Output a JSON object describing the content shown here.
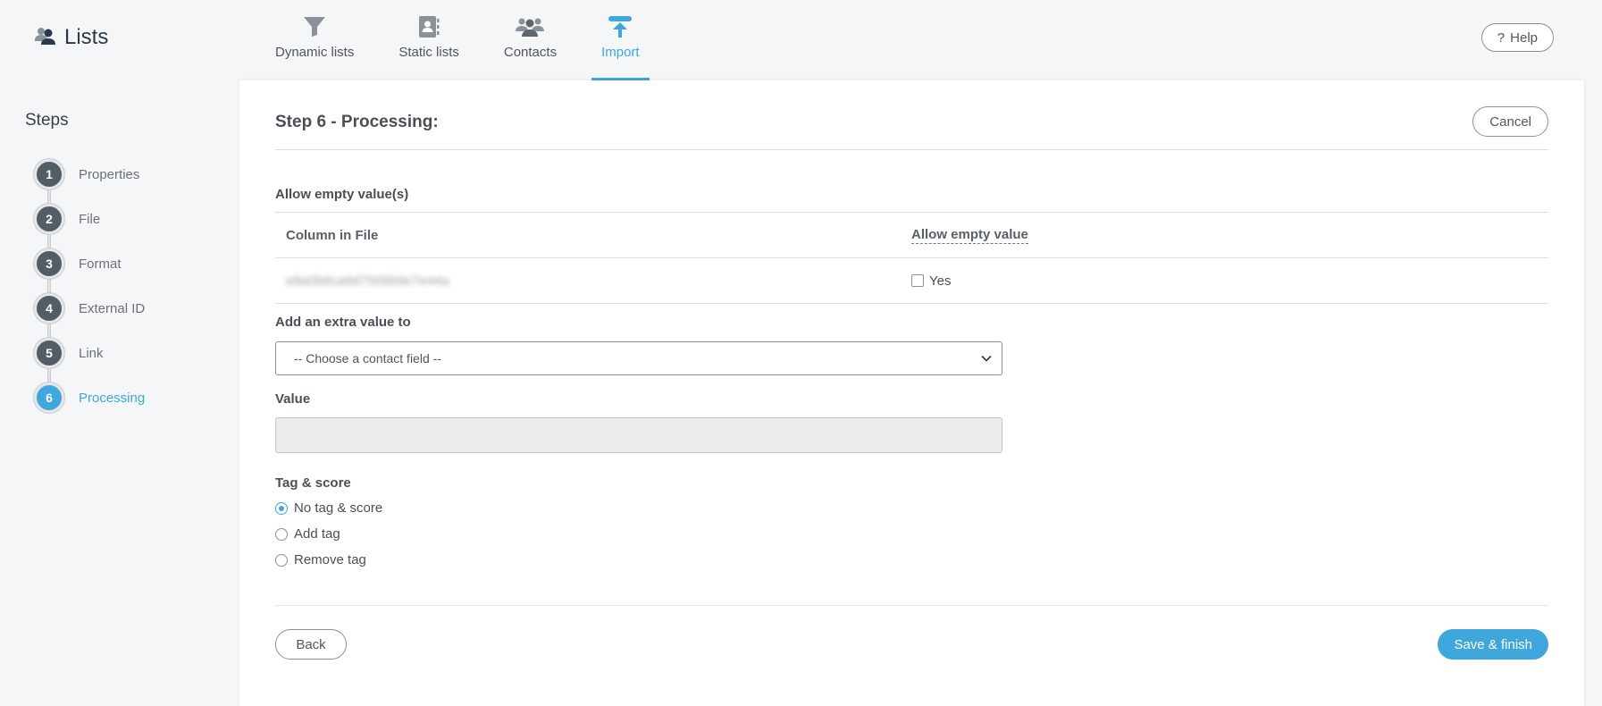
{
  "app": {
    "title": "Lists"
  },
  "nav": {
    "items": [
      {
        "label": "Dynamic lists",
        "icon": "filter-icon"
      },
      {
        "label": "Static lists",
        "icon": "address-book-icon"
      },
      {
        "label": "Contacts",
        "icon": "users-icon"
      },
      {
        "label": "Import",
        "icon": "import-icon",
        "active": true
      }
    ]
  },
  "header": {
    "help_label": "Help"
  },
  "sidebar": {
    "title": "Steps",
    "steps": [
      {
        "number": "1",
        "label": "Properties"
      },
      {
        "number": "2",
        "label": "File"
      },
      {
        "number": "3",
        "label": "Format"
      },
      {
        "number": "4",
        "label": "External ID"
      },
      {
        "number": "5",
        "label": "Link"
      },
      {
        "number": "6",
        "label": "Processing",
        "active": true
      }
    ]
  },
  "main": {
    "title": "Step 6 - Processing:",
    "cancel_label": "Cancel",
    "empty_values": {
      "section_label": "Allow empty value(s)",
      "col_file": "Column in File",
      "col_allow": "Allow empty value",
      "rows": [
        {
          "column": "e8a0b6ca9d7509b9e7e44a",
          "allow_label": "Yes"
        }
      ]
    },
    "extra_value": {
      "label": "Add an extra value to",
      "select_value": "-- Choose a contact field --"
    },
    "value": {
      "label": "Value",
      "current": ""
    },
    "tag_score": {
      "label": "Tag & score",
      "options": [
        {
          "label": "No tag & score",
          "checked": true
        },
        {
          "label": "Add tag"
        },
        {
          "label": "Remove tag"
        }
      ]
    },
    "back_label": "Back",
    "save_label": "Save & finish"
  },
  "colors": {
    "accent": "#3fa7dc",
    "step_dark": "#545c64",
    "text": "#4a4f55"
  }
}
